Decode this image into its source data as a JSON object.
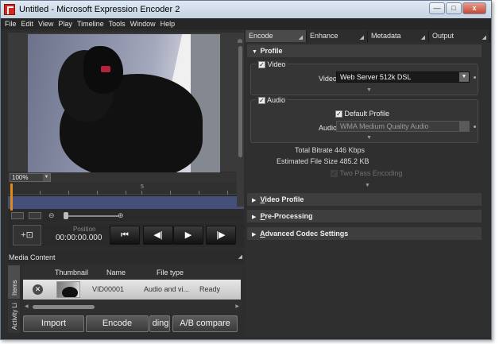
{
  "window": {
    "title": "Untitled - Microsoft Expression Encoder 2",
    "minimize": "—",
    "maximize": "□",
    "close": "x"
  },
  "menu": [
    "File",
    "Edit",
    "View",
    "Play",
    "Timeline",
    "Tools",
    "Window",
    "Help"
  ],
  "tabs": [
    "Encode",
    "Enhance",
    "Metadata",
    "Output"
  ],
  "viewer": {
    "zoom": "100%",
    "ruler_label": "5"
  },
  "transport": {
    "position_label": "Position",
    "position_value": "00:00:00.000"
  },
  "media": {
    "header": "Media Content",
    "tab_items": "Items",
    "tab_activity": "Activity Li",
    "columns": [
      "Thumbnail",
      "Name",
      "File type"
    ],
    "rows": [
      {
        "name": "VID00001",
        "file_type": "Audio and vi...",
        "status": "Ready"
      }
    ],
    "buttons": {
      "import": "Import",
      "encode": "Encode",
      "hidden": "ding",
      "ab_compare": "A/B compare"
    }
  },
  "encode": {
    "profile_header": "Profile",
    "video_group": "Video",
    "video_label": "Video",
    "video_value": "Web Server 512k DSL",
    "audio_group": "Audio",
    "default_profile": "Default Profile",
    "audio_label": "Audio",
    "audio_value": "WMA Medium Quality Audio",
    "total_bitrate": "Total Bitrate 446 Kbps",
    "file_size": "Estimated File Size 485.2 KB",
    "two_pass": "Two Pass Encoding",
    "sections": [
      {
        "first": "V",
        "rest": "ideo Profile"
      },
      {
        "first": "P",
        "rest": "re-Processing"
      },
      {
        "first": "A",
        "rest": "dvanced Codec Settings"
      }
    ]
  }
}
